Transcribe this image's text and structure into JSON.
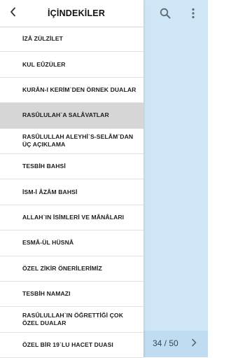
{
  "drawer": {
    "title": "İÇİNDEKİLER",
    "back_icon": "chevron-left-icon",
    "items": [
      {
        "label": "İZÂ ZÜLZİLET",
        "active": false
      },
      {
        "label": "KUL EÛZÜLER",
        "active": false
      },
      {
        "label": "KURÂN-I KERİM`DEN ÖRNEK DUALAR",
        "active": false
      },
      {
        "label": "RASÛLULAH`A SALÂVATLAR",
        "active": true
      },
      {
        "label": "RASÛLULLAH ALEYHİ`S-SELÂM`DAN ÜÇ AÇIKLAMA",
        "active": false
      },
      {
        "label": "TESBİH BAHSİ",
        "active": false
      },
      {
        "label": "İSM-İ ÂZÂM BAHSİ",
        "active": false
      },
      {
        "label": "ALLAH`IN İSİMLERİ VE MÂNÂLARI",
        "active": false
      },
      {
        "label": "ESMÂ-ÜL HÜSNÂ",
        "active": false
      },
      {
        "label": "ÖZEL ZİKİR ÖNERİLERİMİZ",
        "active": false
      },
      {
        "label": "TESBİH NAMAZI",
        "active": false
      },
      {
        "label": "RASÛLULLAH`IN ÖĞRETTİĞİ ÇOK ÖZEL DUALAR",
        "active": false
      },
      {
        "label": "ÖZEL BİR 19`LU HACET DUASI",
        "active": false
      }
    ]
  },
  "toolbar": {
    "search_icon": "search-icon",
    "more_icon": "more-vertical-icon"
  },
  "pagination": {
    "text": "34 / 50",
    "next_icon": "chevron-right-icon"
  },
  "colors": {
    "content_background": "#cfe6f6",
    "active_item": "#d6d6d6",
    "icon": "#5f6b73"
  }
}
